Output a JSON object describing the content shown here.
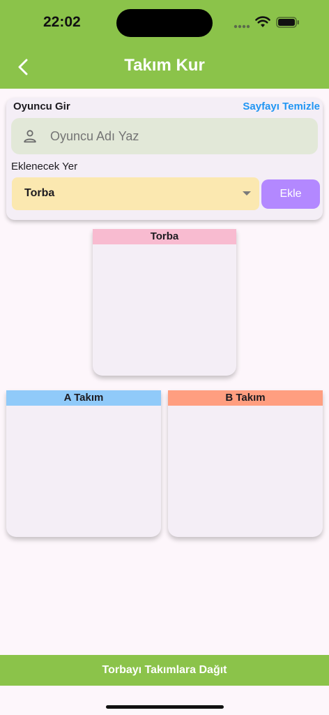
{
  "status_bar": {
    "time": "22:02"
  },
  "app_bar": {
    "title": "Takım Kur"
  },
  "input_card": {
    "label": "Oyuncu Gir",
    "clear_label": "Sayfayı Temizle",
    "name_placeholder": "Oyuncu Adı Yaz",
    "target_label": "Eklenecek Yer",
    "target_value": "Torba",
    "add_label": "Ekle"
  },
  "panels": {
    "torba": {
      "title": "Torba",
      "color": "#f8bbd0"
    },
    "team_a": {
      "title": "A Takım",
      "color": "#90caf9"
    },
    "team_b": {
      "title": "B Takım",
      "color": "#ff9e80"
    }
  },
  "bottom": {
    "distribute_label": "Torbayı Takımlara Dağıt"
  },
  "colors": {
    "primary": "#8bc34a",
    "link": "#2196f3",
    "add_button": "#b388ff",
    "select_bg": "#fbe8b0",
    "input_bg": "#e2e8d8"
  },
  "icons": {
    "back": "chevron-left-icon",
    "person": "person-icon",
    "dropdown": "caret-down-icon",
    "wifi": "wifi-icon",
    "battery": "battery-icon",
    "signal": "signal-icon"
  }
}
